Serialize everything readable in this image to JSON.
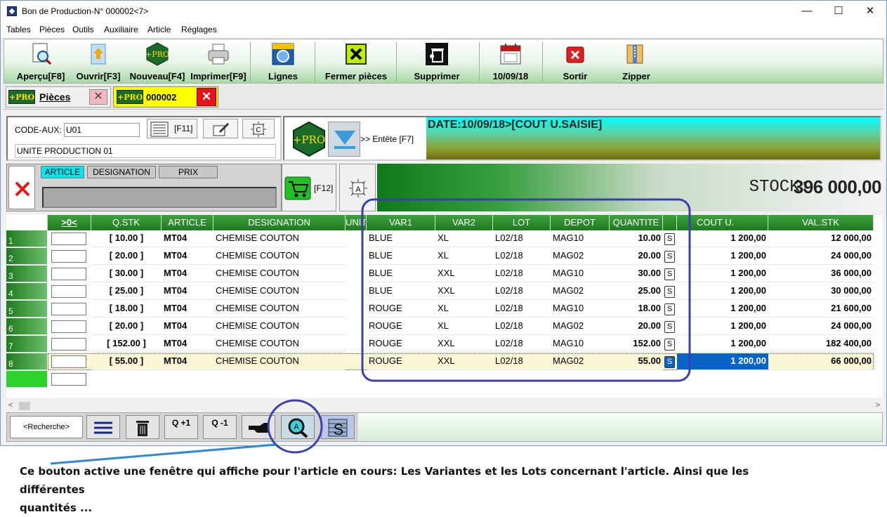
{
  "window": {
    "title": "Bon de Production-N° 000002<7>",
    "controls": [
      "—",
      "☐",
      "✕"
    ]
  },
  "menu": [
    "Tables",
    "Pièces",
    "Outils",
    "Auxiliaire",
    "Article",
    "Réglages"
  ],
  "toolbar": [
    {
      "label": "Aperçu[F8]",
      "icon": "preview-icon"
    },
    {
      "label": "Ouvrir[F3]",
      "icon": "open-icon"
    },
    {
      "label": "Nouveau[F4]",
      "icon": "new-icon"
    },
    {
      "label": "Imprimer[F9]",
      "icon": "printer-icon"
    },
    {
      "label": "Lignes",
      "icon": "lines-icon"
    },
    {
      "label": "Fermer pièces",
      "icon": "close-doc-icon"
    },
    {
      "label": "Supprimer",
      "icon": "trash-icon"
    },
    {
      "label": "10/09/18",
      "icon": "calendar-icon"
    },
    {
      "label": "Sortir",
      "icon": "exit-icon"
    },
    {
      "label": "Zipper",
      "icon": "zip-icon"
    }
  ],
  "tabs": {
    "pieces": "Pièces",
    "document": "000002",
    "logo_text": "+PRO"
  },
  "supplier": {
    "code_label": "CODE-AUX:",
    "code_value": "U01",
    "f11": "[F11]",
    "name": "UNITE PRODUCTION 01"
  },
  "entete": {
    "button": ">> Entête [F7]",
    "banner": "DATE:10/09/18>[COUT U.SAISIE]"
  },
  "article_panel": {
    "tabs": [
      "ARTICLE",
      "DESIGNATION",
      "PRIX"
    ],
    "f12": "[F12]"
  },
  "stock": {
    "label": "STOCK:",
    "value": "396 000,00"
  },
  "grid": {
    "columns": [
      ">0<",
      "Q.STK",
      "ARTICLE",
      "DESIGNATION",
      "UNIT",
      "VAR1",
      "VAR2",
      "LOT",
      "DEPOT",
      "QUANTITE",
      "",
      "COUT U.",
      "VAL.STK"
    ],
    "rows": [
      {
        "n": "1",
        "qstk": "[ 10.00 ]",
        "article": "MT04",
        "designation": "CHEMISE COUTON",
        "var1": "BLUE",
        "var2": "XL",
        "lot": "L02/18",
        "depot": "MAG10",
        "quantite": "10.00",
        "s": "S",
        "cout": "1 200,00",
        "val": "12 000,00"
      },
      {
        "n": "2",
        "qstk": "[ 20.00 ]",
        "article": "MT04",
        "designation": "CHEMISE COUTON",
        "var1": "BLUE",
        "var2": "XL",
        "lot": "L02/18",
        "depot": "MAG02",
        "quantite": "20.00",
        "s": "S",
        "cout": "1 200,00",
        "val": "24 000,00"
      },
      {
        "n": "3",
        "qstk": "[ 30.00 ]",
        "article": "MT04",
        "designation": "CHEMISE COUTON",
        "var1": "BLUE",
        "var2": "XXL",
        "lot": "L02/18",
        "depot": "MAG10",
        "quantite": "30.00",
        "s": "S",
        "cout": "1 200,00",
        "val": "36 000,00"
      },
      {
        "n": "4",
        "qstk": "[ 25.00 ]",
        "article": "MT04",
        "designation": "CHEMISE COUTON",
        "var1": "BLUE",
        "var2": "XXL",
        "lot": "L02/18",
        "depot": "MAG02",
        "quantite": "25.00",
        "s": "S",
        "cout": "1 200,00",
        "val": "30 000,00"
      },
      {
        "n": "5",
        "qstk": "[ 18.00 ]",
        "article": "MT04",
        "designation": "CHEMISE COUTON",
        "var1": "ROUGE",
        "var2": "XL",
        "lot": "L02/18",
        "depot": "MAG10",
        "quantite": "18.00",
        "s": "S",
        "cout": "1 200,00",
        "val": "21 600,00"
      },
      {
        "n": "6",
        "qstk": "[ 20.00 ]",
        "article": "MT04",
        "designation": "CHEMISE COUTON",
        "var1": "ROUGE",
        "var2": "XL",
        "lot": "L02/18",
        "depot": "MAG02",
        "quantite": "20.00",
        "s": "S",
        "cout": "1 200,00",
        "val": "24 000,00"
      },
      {
        "n": "7",
        "qstk": "[ 152.00 ]",
        "article": "MT04",
        "designation": "CHEMISE COUTON",
        "var1": "ROUGE",
        "var2": "XXL",
        "lot": "L02/18",
        "depot": "MAG10",
        "quantite": "152.00",
        "s": "S",
        "cout": "1 200,00",
        "val": "182 400,00"
      },
      {
        "n": "8",
        "qstk": "[ 55.00 ]",
        "article": "MT04",
        "designation": "CHEMISE COUTON",
        "var1": "ROUGE",
        "var2": "XXL",
        "lot": "L02/18",
        "depot": "MAG02",
        "quantite": "55.00",
        "s": "S",
        "cout": "1 200,00",
        "val": "66 000,00"
      }
    ]
  },
  "bottom": {
    "search": "<Recherche>",
    "q_plus": "Q +1",
    "q_minus": "Q -1"
  },
  "annotation": {
    "line1": "Ce bouton active une fenêtre qui affiche pour l'article en cours: Les Variantes  et  les Lots concernant l'article.  Ainsi que les différentes",
    "line2": "quantités ..."
  },
  "colors": {
    "highlight_circle": "#3a3fb0",
    "grid_header": "#1e7a1e",
    "selected_cell": "#0a64c8",
    "selected_row": "#fbf7d4"
  }
}
